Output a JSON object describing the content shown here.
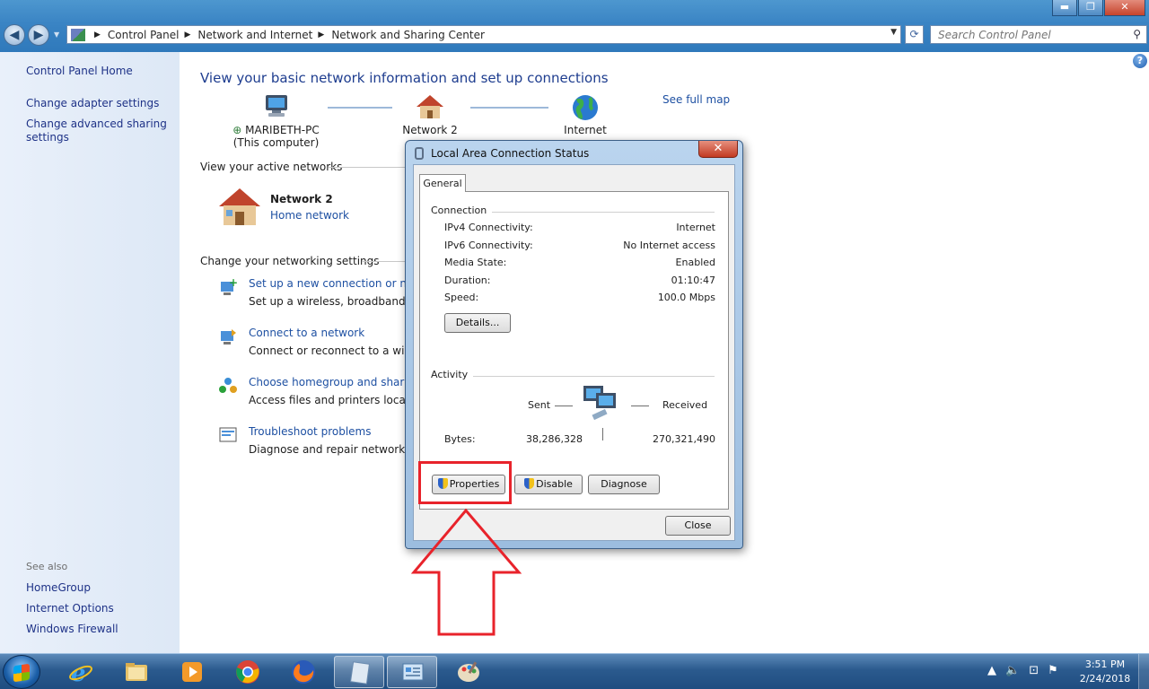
{
  "window": {
    "controls": {
      "minimize": "▬",
      "maximize": "❐",
      "close": "✕"
    }
  },
  "address_bar": {
    "crumbs": [
      "Control Panel",
      "Network and Internet",
      "Network and Sharing Center"
    ],
    "search_placeholder": "Search Control Panel"
  },
  "left_pane": {
    "home": "Control Panel Home",
    "links": [
      "Change adapter settings",
      "Change advanced sharing settings"
    ],
    "see_also_label": "See also",
    "see_also": [
      "HomeGroup",
      "Internet Options",
      "Windows Firewall"
    ]
  },
  "main": {
    "title": "View your basic network information and set up connections",
    "map": {
      "computer_name": "MARIBETH-PC",
      "computer_sub": "(This computer)",
      "network": "Network  2",
      "internet": "Internet",
      "see_full_map": "See full map"
    },
    "active_label": "View your active networks",
    "active_network": {
      "name": "Network  2",
      "type": "Home network"
    },
    "settings_label": "Change your networking settings",
    "tasks": [
      {
        "link": "Set up a new connection or network",
        "desc": "Set up a wireless, broadband, dial-up"
      },
      {
        "link": "Connect to a network",
        "desc": "Connect or reconnect to a wireless"
      },
      {
        "link": "Choose homegroup and sharing",
        "desc": "Access files and printers located"
      },
      {
        "link": "Troubleshoot problems",
        "desc": "Diagnose and repair network problems"
      }
    ]
  },
  "dialog": {
    "title": "Local Area Connection Status",
    "tab": "General",
    "connection_label": "Connection",
    "rows": [
      {
        "key": "IPv4 Connectivity:",
        "value": "Internet"
      },
      {
        "key": "IPv6 Connectivity:",
        "value": "No Internet access"
      },
      {
        "key": "Media State:",
        "value": "Enabled"
      },
      {
        "key": "Duration:",
        "value": "01:10:47"
      },
      {
        "key": "Speed:",
        "value": "100.0 Mbps"
      }
    ],
    "details_button": "Details...",
    "activity_label": "Activity",
    "sent_label": "Sent",
    "received_label": "Received",
    "bytes_label": "Bytes:",
    "bytes_sent": "38,286,328",
    "bytes_received": "270,321,490",
    "properties_button": "Properties",
    "disable_button": "Disable",
    "diagnose_button": "Diagnose",
    "close_button": "Close"
  },
  "taskbar": {
    "clock_time": "3:51 PM",
    "clock_date": "2/24/2018",
    "apps": [
      "internet-explorer",
      "file-explorer",
      "media-player",
      "chrome",
      "firefox",
      "notepad",
      "control-panel",
      "paint"
    ]
  },
  "colors": {
    "link": "#1e50a2",
    "title": "#1e3d8f",
    "annotation": "#e8232b"
  }
}
